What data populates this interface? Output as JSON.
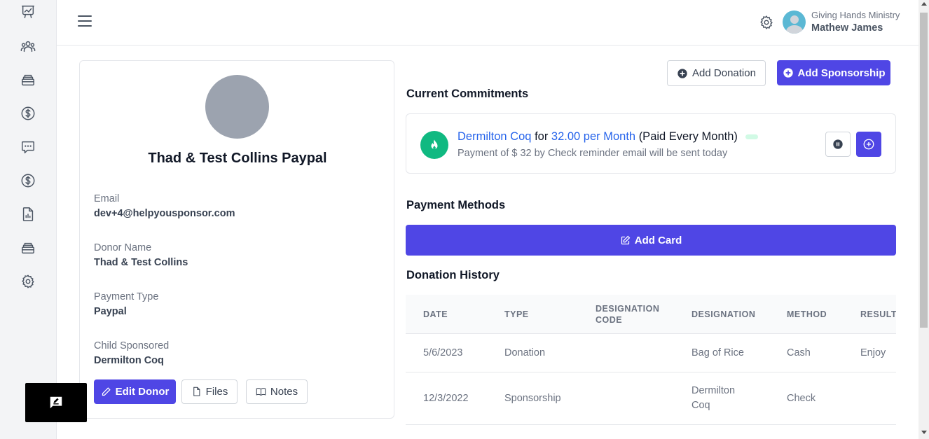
{
  "sidebar": {
    "items": [
      {
        "icon": "presentation-chart-icon"
      },
      {
        "icon": "users-group-icon"
      },
      {
        "icon": "archive-box-icon"
      },
      {
        "icon": "dollar-circle-icon"
      },
      {
        "icon": "chat-bubble-icon"
      },
      {
        "icon": "dollar-circle-icon"
      },
      {
        "icon": "document-report-icon"
      },
      {
        "icon": "archive-box-icon"
      },
      {
        "icon": "gear-icon"
      }
    ]
  },
  "header": {
    "org_name": "Giving Hands Ministry",
    "user_name": "Mathew James"
  },
  "profile": {
    "name": "Thad & Test Collins Paypal",
    "fields": [
      {
        "label": "Email",
        "value": "dev+4@helpyousponsor.com"
      },
      {
        "label": "Donor Name",
        "value": "Thad & Test Collins"
      },
      {
        "label": "Payment Type",
        "value": "Paypal"
      },
      {
        "label": "Child Sponsored",
        "value": "Dermilton Coq"
      }
    ],
    "edit_label": "Edit Donor",
    "files_label": "Files",
    "notes_label": "Notes"
  },
  "actions": {
    "add_donation": "Add Donation",
    "add_sponsorship": "Add Sponsorship"
  },
  "commitments": {
    "title": "Current Commitments",
    "item": {
      "name": "Dermilton Coq",
      "for_text": "for",
      "amount": "32.00 per Month",
      "frequency": "(Paid Every Month)",
      "subtext": "Payment of $ 32 by Check reminder email will be sent today"
    }
  },
  "payment_methods": {
    "title": "Payment Methods",
    "add_card": "Add Card"
  },
  "history": {
    "title": "Donation History",
    "columns": [
      "DATE",
      "TYPE",
      "DESIGNATION CODE",
      "DESIGNATION",
      "METHOD",
      "RESULT"
    ],
    "rows": [
      {
        "date": "5/6/2023",
        "type": "Donation",
        "code": "",
        "designation": "Bag of Rice",
        "method": "Cash",
        "result": "Enjoy"
      },
      {
        "date": "12/3/2022",
        "type": "Sponsorship",
        "code": "",
        "designation": "Dermilton Coq",
        "method": "Check",
        "result": ""
      }
    ]
  },
  "colors": {
    "primary": "#4f46e5",
    "link": "#2563eb",
    "success": "#10b981"
  }
}
